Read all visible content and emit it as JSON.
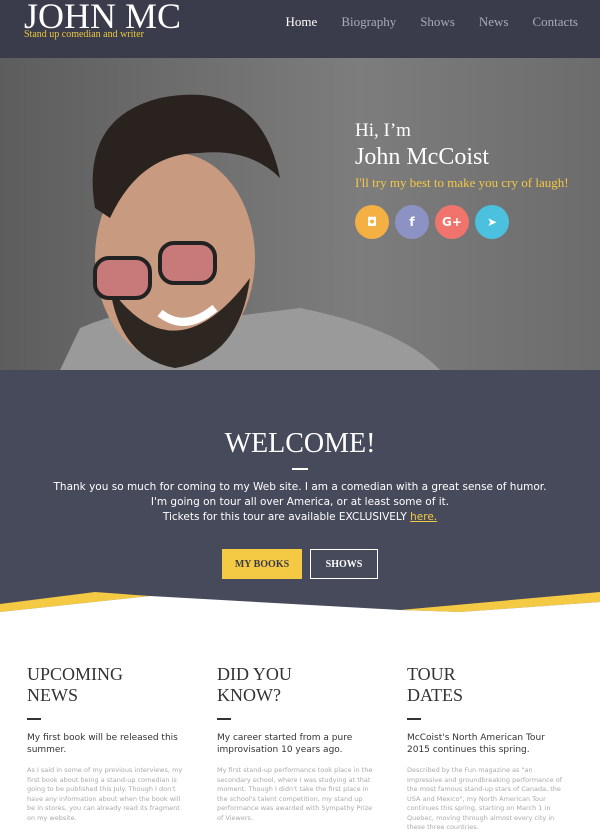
{
  "header": {
    "logo": "JOHN MC",
    "tagline": "Stand up comedian and writer",
    "nav": [
      "Home",
      "Biography",
      "Shows",
      "News",
      "Contacts"
    ]
  },
  "hero": {
    "greeting": "Hi, I’m",
    "name": "John McCoist",
    "slogan": "I'll try my best to make you cry of laugh!",
    "socials": [
      {
        "icon": "instagram-icon",
        "glyph": "◘",
        "color": "#f4b043"
      },
      {
        "icon": "facebook-icon",
        "glyph": "f",
        "color": "#8c93c4"
      },
      {
        "icon": "google-plus-icon",
        "glyph": "G+",
        "color": "#f0746b"
      },
      {
        "icon": "twitter-icon",
        "glyph": "🐦",
        "color": "#4cc0df"
      }
    ]
  },
  "welcome": {
    "title": "WELCOME!",
    "line1": "Thank you so much for coming to my Web site. I am a comedian with a great sense of humor.",
    "line2": "I'm going on tour all over America, or at least some of it.",
    "line3": "Tickets for this tour are available EXCLUSIVELY ",
    "link": "here.",
    "btn_books": "MY BOOKS",
    "btn_shows": "SHOWS"
  },
  "columns": [
    {
      "title1": "UPCOMING",
      "title2": "NEWS",
      "lead": "My first book will be released this summer.",
      "body": "As I said in some of my previous interviews, my first book about being a stand-up comedian is going to be published this July. Though I don't have any information about when the book will be in stores, you can already read its fragment on my website."
    },
    {
      "title1": "DID YOU",
      "title2": "KNOW?",
      "lead": "My career started from a pure improvisation 10 years ago.",
      "body": "My first stand-up performance took place in the secondary school, where I was studying at that moment. Though I didn't take the first place in the school's talent competition, my stand up performance was awarded with Sympathy Prize of Viewers."
    },
    {
      "title1": "TOUR",
      "title2": "DATES",
      "lead": "McCoist's North American Tour 2015 continues this spring.",
      "body": "Described by the Fun magazine as \"an impressive and groundbreaking performance of the most famous stand-up stars of Canada, the USA and Mexico\", my North American Tour continues this spring, starting on March 1 in Quebec, moving through almost every city in these three countries."
    }
  ]
}
